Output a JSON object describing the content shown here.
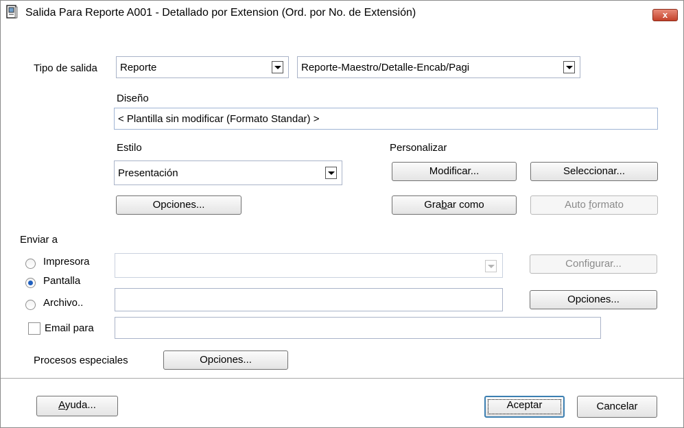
{
  "window": {
    "title": "Salida Para Reporte A001 - Detallado por Extension (Ord. por No. de Extensión)",
    "close_label": "x"
  },
  "output": {
    "type_label": "Tipo de salida",
    "type_value": "Reporte",
    "format_value": "Reporte-Maestro/Detalle-Encab/Pagi",
    "design_label": "Diseño",
    "design_value": "< Plantilla sin modificar (Formato Standar) >",
    "style_label": "Estilo",
    "style_value": "Presentación",
    "customize_label": "Personalizar",
    "options_btn": "Opciones...",
    "modify_btn": "Modificar...",
    "select_btn": "Seleccionar...",
    "save_as_pre": "Gra",
    "save_as_u": "b",
    "save_as_post": "ar como",
    "auto_format_pre": "Auto ",
    "auto_format_u": "f",
    "auto_format_post": "ormato"
  },
  "send_to": {
    "label": "Enviar a",
    "printer_label": "Impresora",
    "printer_value": "",
    "configure_btn": "Configurar...",
    "screen_label": "Pantalla",
    "file_label": "Archivo..",
    "file_value": "",
    "file_options_btn": "Opciones...",
    "email_label": "Email para",
    "email_value": "",
    "selected": "Pantalla"
  },
  "special": {
    "label": "Procesos especiales",
    "options_btn": "Opciones..."
  },
  "footer": {
    "help_u": "A",
    "help_post": "yuda...",
    "accept_btn": "Aceptar",
    "cancel_btn": "Cancelar"
  }
}
